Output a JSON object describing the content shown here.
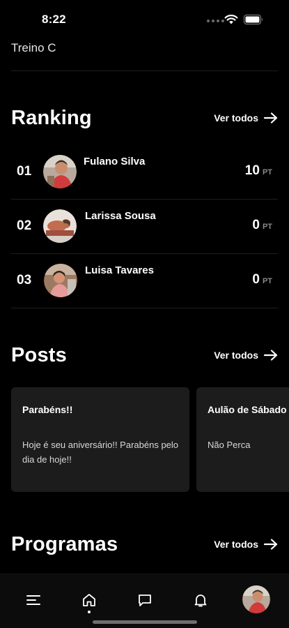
{
  "status_bar": {
    "time": "8:22"
  },
  "top_item": {
    "label": "Treino C"
  },
  "ranking": {
    "title": "Ranking",
    "see_all": "Ver todos",
    "unit": "PT",
    "rows": [
      {
        "position": "01",
        "name": "Fulano Silva",
        "points": "10"
      },
      {
        "position": "02",
        "name": "Larissa Sousa",
        "points": "0"
      },
      {
        "position": "03",
        "name": "Luisa Tavares",
        "points": "0"
      }
    ]
  },
  "posts": {
    "title": "Posts",
    "see_all": "Ver todos",
    "items": [
      {
        "title": "Parabéns!!",
        "body": "Hoje é seu aniversário!! Parabéns pelo dia de hoje!!"
      },
      {
        "title": "Aulão de Sábado",
        "body": "Não Perca"
      }
    ]
  },
  "programs": {
    "title": "Programas",
    "see_all": "Ver todos"
  },
  "bottom_nav": {
    "items": [
      "menu-icon",
      "home-icon",
      "chat-icon",
      "bell-icon",
      "profile-avatar"
    ],
    "active": "home"
  },
  "colors": {
    "background": "#000000",
    "card": "#1c1c1c",
    "text": "#ffffff",
    "muted": "#8a8a8a"
  }
}
